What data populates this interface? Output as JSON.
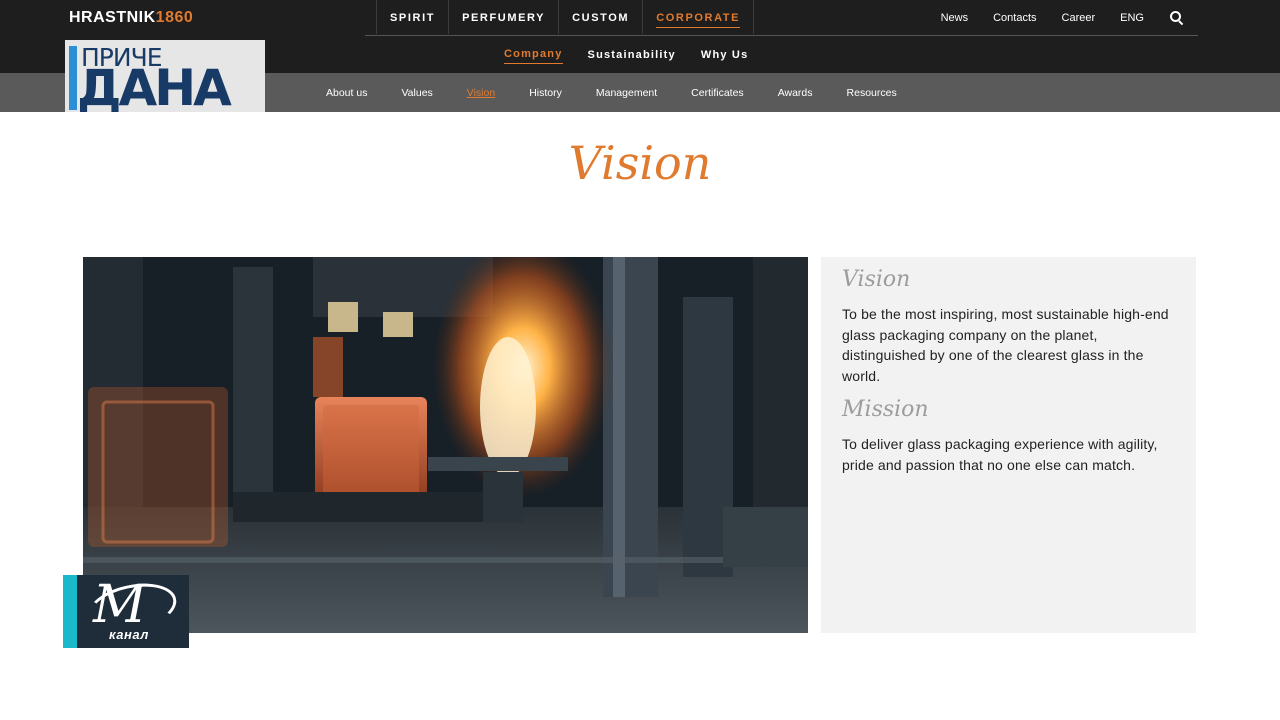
{
  "brand": {
    "name": "HRASTNIK",
    "year": "1860"
  },
  "main_nav": [
    "SPIRIT",
    "PERFUMERY",
    "CUSTOM",
    "CORPORATE"
  ],
  "main_nav_active": "CORPORATE",
  "utility_nav": [
    "News",
    "Contacts",
    "Career",
    "ENG"
  ],
  "sub_nav": [
    "Company",
    "Sustainability",
    "Why Us"
  ],
  "sub_nav_active": "Company",
  "third_nav": [
    "About us",
    "Values",
    "Vision",
    "History",
    "Management",
    "Certificates",
    "Awards",
    "Resources"
  ],
  "third_nav_active": "Vision",
  "page": {
    "title": "Vision",
    "vision_heading": "Vision",
    "vision_text": "To be the most inspiring, most sustainable high-end glass packaging company on the planet, distinguished by one of the clearest glass in the world.",
    "mission_heading": "Mission",
    "mission_text": "To deliver glass packaging experience with agility, pride and passion that no one else can match."
  },
  "overlays": {
    "tv_show_line1": "ПРИЧЕ",
    "tv_show_line2": "ДАНА",
    "channel_letter": "M",
    "channel_name": "канал"
  },
  "colors": {
    "accent": "#e07a2f",
    "dark_bar": "#1e1e1e",
    "gray_bar": "#5a5a5a",
    "panel": "#f2f2f2"
  },
  "icons": [
    "search-icon",
    "glass-factory-photo"
  ]
}
